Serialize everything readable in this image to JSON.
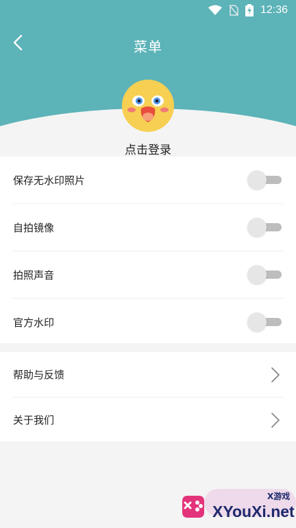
{
  "status_bar": {
    "time": "12:36"
  },
  "header": {
    "title": "菜单"
  },
  "profile": {
    "login_label": "点击登录"
  },
  "settings": [
    {
      "label": "保存无水印照片",
      "enabled": false
    },
    {
      "label": "自拍镜像",
      "enabled": false
    },
    {
      "label": "拍照声音",
      "enabled": false
    },
    {
      "label": "官方水印",
      "enabled": false
    }
  ],
  "links": [
    {
      "label": "帮助与反馈"
    },
    {
      "label": "关于我们"
    }
  ],
  "watermark": {
    "text": "XYouXi.net",
    "small": "X游戏"
  },
  "colors": {
    "header": "#5cb3b8",
    "background": "#f4f4f4"
  }
}
